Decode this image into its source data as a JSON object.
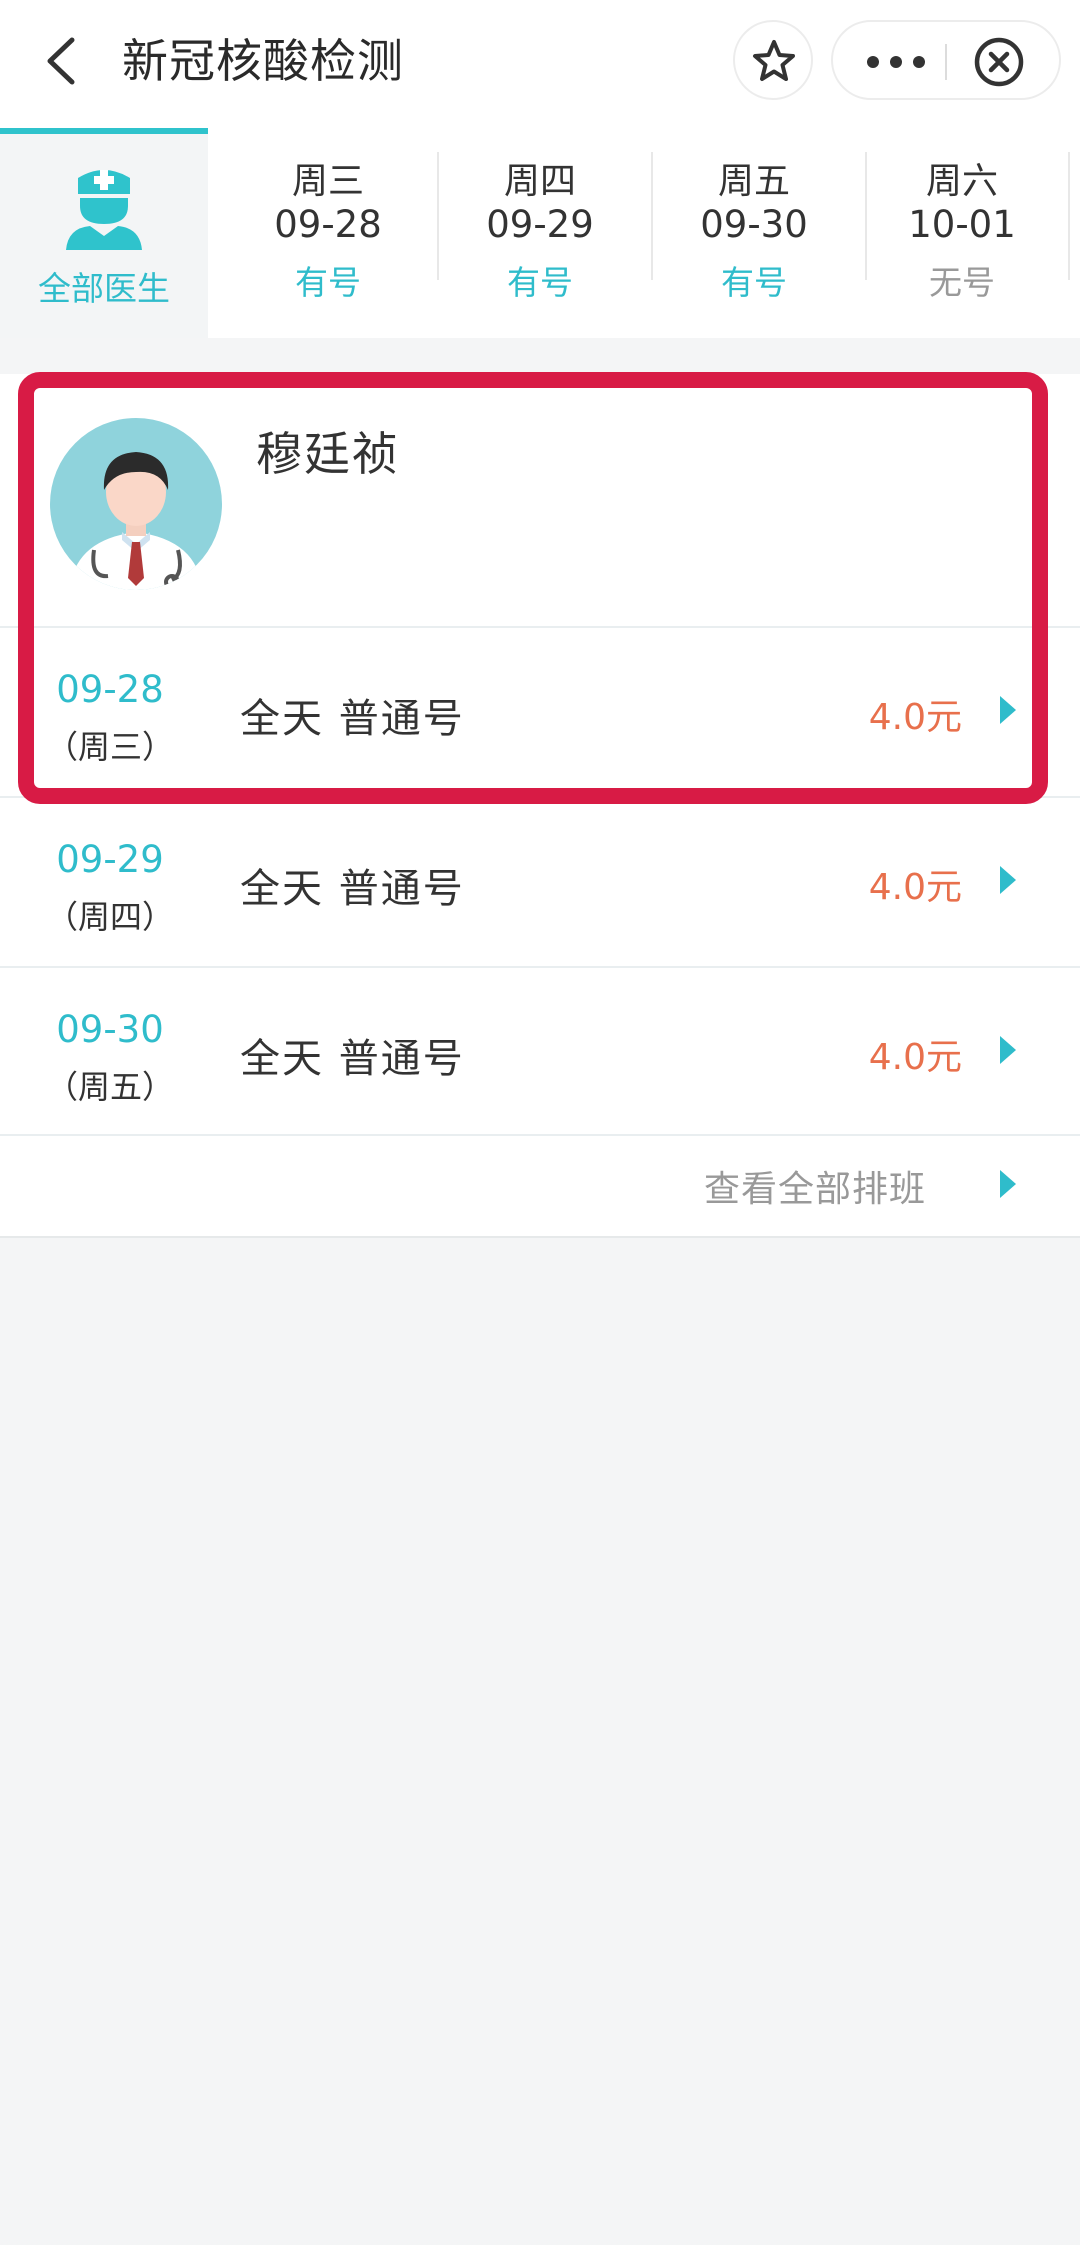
{
  "header": {
    "title": "新冠核酸检测",
    "back_icon": "chevron-left-icon",
    "favorite_icon": "star-icon",
    "more_icon": "more-dots-icon",
    "close_icon": "close-circle-icon"
  },
  "tabs": {
    "all": {
      "label": "全部医生",
      "icon": "doctor-icon"
    },
    "days": [
      {
        "weekday": "周三",
        "date": "09-28",
        "status": "有号"
      },
      {
        "weekday": "周四",
        "date": "09-29",
        "status": "有号"
      },
      {
        "weekday": "周五",
        "date": "09-30",
        "status": "有号"
      },
      {
        "weekday": "周六",
        "date": "10-01",
        "status": "无号"
      }
    ]
  },
  "doctor": {
    "name": "穆廷祯",
    "avatar_icon": "doctor-avatar"
  },
  "schedule": [
    {
      "date": "09-28",
      "weekday": "（周三）",
      "type": "全天  普通号",
      "price": "4.0元"
    },
    {
      "date": "09-29",
      "weekday": "（周四）",
      "type": "全天  普通号",
      "price": "4.0元"
    },
    {
      "date": "09-30",
      "weekday": "（周五）",
      "type": "全天  普通号",
      "price": "4.0元"
    }
  ],
  "view_all": {
    "label": "查看全部排班"
  },
  "colors": {
    "accent": "#2fbccb",
    "price": "#e8704c",
    "highlight": "#d81b45",
    "background": "#f4f5f6"
  }
}
